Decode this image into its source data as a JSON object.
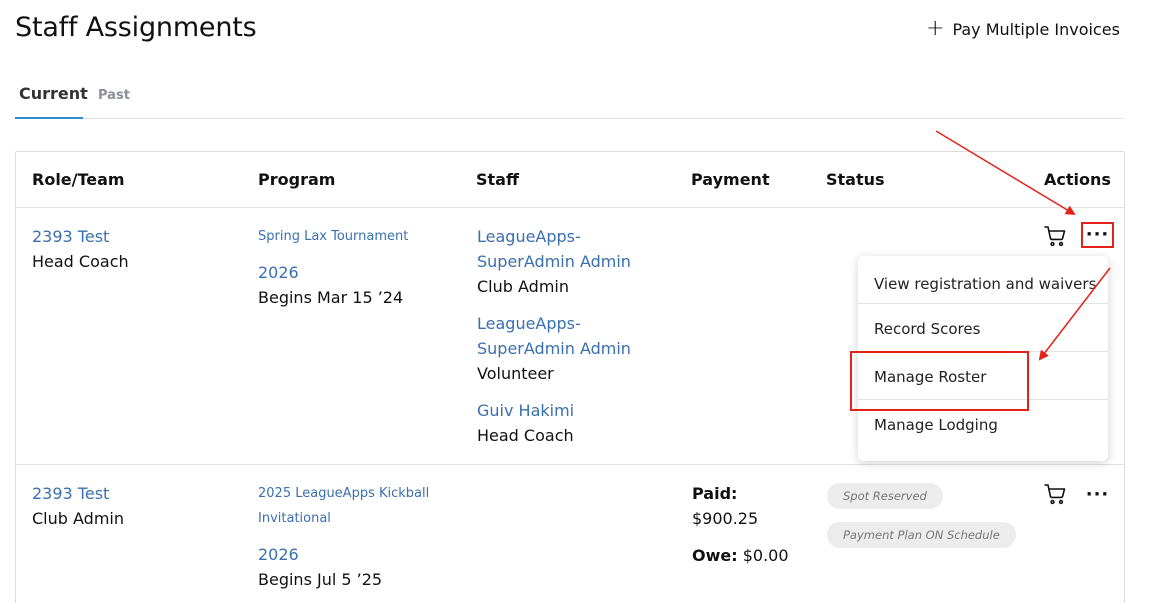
{
  "header": {
    "title": "Staff Assignments",
    "pay_multiple_plus": "+",
    "pay_multiple_label": "Pay Multiple Invoices"
  },
  "tabs": [
    {
      "label": "Current",
      "active": true
    },
    {
      "label": "Past",
      "active": false
    }
  ],
  "table": {
    "columns": [
      "Role/Team",
      "Program",
      "Staff",
      "Payment",
      "Status",
      "Actions"
    ],
    "rows": [
      {
        "team": "2393 Test",
        "role": "Head Coach",
        "program": "Spring Lax Tournament",
        "year": "2026",
        "begins": "Begins Mar 15 ’24",
        "staff": [
          {
            "name_line1": "LeagueApps-",
            "name_line2": "SuperAdmin Admin",
            "role": "Club Admin"
          },
          {
            "name_line1": "LeagueApps-",
            "name_line2": "SuperAdmin Admin",
            "role": "Volunteer"
          },
          {
            "name_line1": "Guiv Hakimi",
            "role": "Head Coach"
          }
        ]
      },
      {
        "team": "2393 Test",
        "role": "Club Admin",
        "program_line1": "2025 LeagueApps Kickball",
        "program_line2": "Invitational",
        "year": "2026",
        "begins": "Begins Jul 5 ’25",
        "payment": {
          "paid_label": "Paid:",
          "paid_value": "$900.25",
          "owe_label": "Owe:",
          "owe_value": "$0.00"
        },
        "status_badges": [
          "Spot Reserved",
          "Payment Plan ON Schedule"
        ]
      }
    ]
  },
  "actions_menu": {
    "items": [
      "View registration and waivers",
      "Record Scores",
      "Manage Roster",
      "Manage Lodging"
    ]
  },
  "icons": {
    "cart": "cart-icon",
    "more": "more-horizontal-icon",
    "plus": "plus-icon"
  },
  "colors": {
    "link": "#3a6fb0",
    "tab_underline": "#2b8fd6",
    "annotation": "#e2231a"
  }
}
